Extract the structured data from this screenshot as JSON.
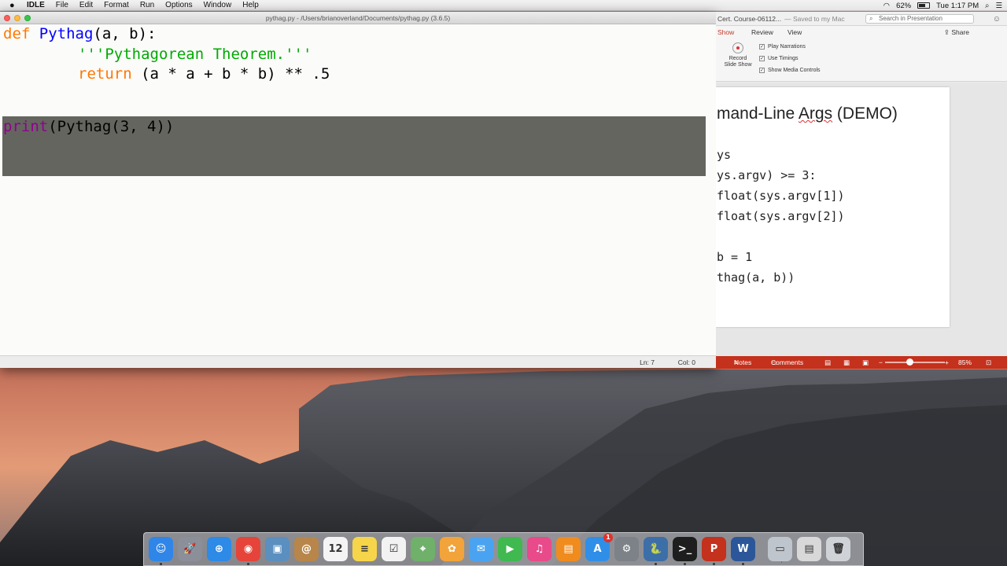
{
  "menubar": {
    "apple": "",
    "items": [
      "IDLE",
      "File",
      "Edit",
      "Format",
      "Run",
      "Options",
      "Window",
      "Help"
    ],
    "battery_percent": "62%",
    "clock": "Tue 1:17 PM"
  },
  "idle_window": {
    "title": "pythag.py - /Users/brianoverland/Documents/pythag.py (3.6.5)",
    "code": {
      "line1_kw": "def",
      "line1_name": "Pythag",
      "line1_rest": "(a, b):",
      "line2_str": "'''Pythagorean Theorem.'''",
      "line3_kw": "return",
      "line3_rest": " (a * a + b * b) ** .5",
      "line5_builtin": "print",
      "line5_rest": "(Pythag(3, 4))"
    },
    "status": {
      "ln": "Ln: 7",
      "col": "Col: 0"
    }
  },
  "ppt_window": {
    "title": "Cert. Course-06112...",
    "saved": "— Saved to my Mac",
    "search_placeholder": "Search in Presentation",
    "tabs": [
      "Show",
      "Review",
      "View"
    ],
    "share": "Share",
    "record_label_1": "Record",
    "record_label_2": "Slide Show",
    "checkboxes": [
      "Play Narrations",
      "Use Timings",
      "Show Media Controls"
    ],
    "slide_title_prefix": "mand-Line ",
    "slide_title_args": "Args",
    "slide_title_suffix": " (DEMO)",
    "slide_code_lines": [
      "ys",
      "ys.argv) >= 3:",
      "float(sys.argv[1])",
      "float(sys.argv[2])",
      "",
      "b = 1",
      "thag(a, b))"
    ],
    "status": {
      "notes": "Notes",
      "comments": "Comments",
      "zoom": "85%"
    }
  },
  "dock": {
    "apps": [
      {
        "name": "finder",
        "glyph": "☺",
        "color": "#2f86e8"
      },
      {
        "name": "launchpad",
        "glyph": "🚀",
        "color": "#8a8f99"
      },
      {
        "name": "safari",
        "glyph": "⊕",
        "color": "#2d8ae6"
      },
      {
        "name": "chrome",
        "glyph": "◉",
        "color": "#e6443a"
      },
      {
        "name": "preview",
        "glyph": "▣",
        "color": "#5a8fc0"
      },
      {
        "name": "contacts",
        "glyph": "@",
        "color": "#b8864a"
      },
      {
        "name": "calendar",
        "glyph": "12",
        "color": "#f4f4f4"
      },
      {
        "name": "notes",
        "glyph": "≡",
        "color": "#f6d54a"
      },
      {
        "name": "reminders",
        "glyph": "☑",
        "color": "#f2f2f2"
      },
      {
        "name": "maps",
        "glyph": "⌖",
        "color": "#6fb06a"
      },
      {
        "name": "photos",
        "glyph": "✿",
        "color": "#f2a33a"
      },
      {
        "name": "messages",
        "glyph": "✉",
        "color": "#4aa3f0"
      },
      {
        "name": "facetime",
        "glyph": "▶",
        "color": "#3fb950"
      },
      {
        "name": "itunes",
        "glyph": "♫",
        "color": "#e84a8a"
      },
      {
        "name": "ibooks",
        "glyph": "▤",
        "color": "#f08b1e"
      },
      {
        "name": "app-store",
        "glyph": "A",
        "color": "#2f8fe8",
        "badge": "1"
      },
      {
        "name": "system-preferences",
        "glyph": "⚙",
        "color": "#7d8288"
      },
      {
        "name": "python-idle",
        "glyph": "🐍",
        "color": "#3c6fa8"
      },
      {
        "name": "terminal",
        "glyph": ">_",
        "color": "#1e1e1e"
      },
      {
        "name": "powerpoint",
        "glyph": "P",
        "color": "#c4311c"
      },
      {
        "name": "word",
        "glyph": "W",
        "color": "#2b579a"
      },
      {
        "name": "documents-folder",
        "glyph": "▭",
        "color": "#bfc5cc"
      },
      {
        "name": "downloads-stack",
        "glyph": "▤",
        "color": "#d8d8d8"
      },
      {
        "name": "trash",
        "glyph": "🗑",
        "color": "#cfd3d8"
      }
    ]
  }
}
